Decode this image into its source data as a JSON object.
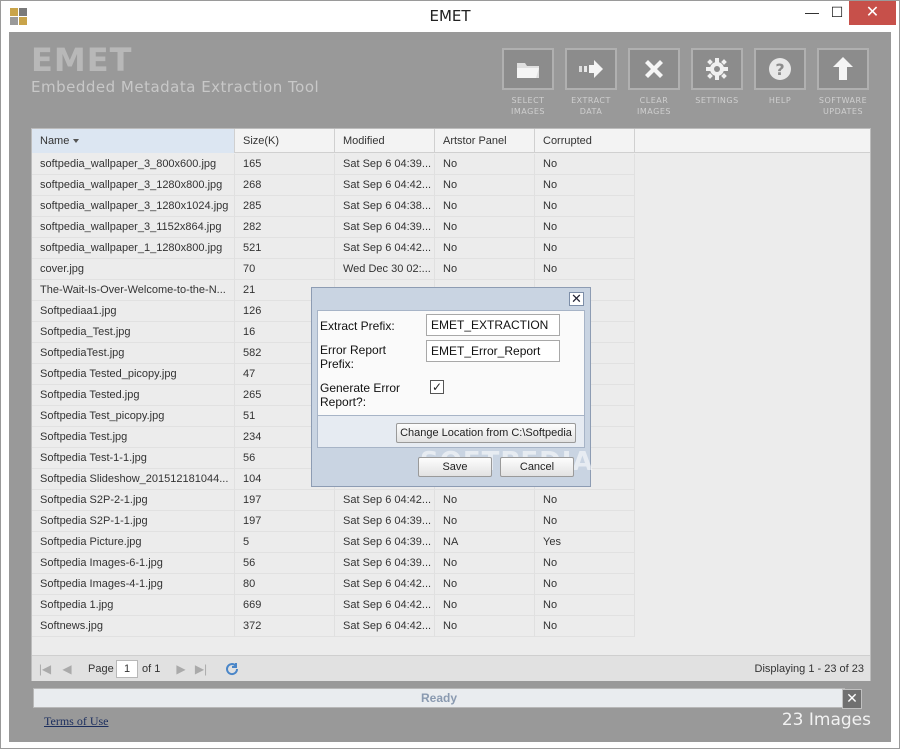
{
  "window": {
    "title": "EMET",
    "controls": {
      "minimize": "—",
      "maximize": "☐",
      "close": "✕"
    }
  },
  "brand": {
    "title": "EMET",
    "subtitle": "Embedded Metadata Extraction Tool"
  },
  "toolbar": [
    {
      "line1": "SELECT",
      "line2": "IMAGES",
      "icon": "folder-icon"
    },
    {
      "line1": "EXTRACT",
      "line2": "DATA",
      "icon": "arrow-right-icon"
    },
    {
      "line1": "CLEAR",
      "line2": "IMAGES",
      "icon": "close-x-icon"
    },
    {
      "line1": "SETTINGS",
      "line2": "",
      "icon": "gear-icon"
    },
    {
      "line1": "HELP",
      "line2": "",
      "icon": "help-icon"
    },
    {
      "line1": "SOFTWARE",
      "line2": "UPDATES",
      "icon": "arrow-up-icon"
    }
  ],
  "table": {
    "columns": [
      "Name",
      "Size(K)",
      "Modified",
      "Artstor Panel",
      "Corrupted"
    ],
    "sorted_column": "Name",
    "rows": [
      [
        "softpedia_wallpaper_3_800x600.jpg",
        "165",
        "Sat Sep 6 04:39...",
        "No",
        "No"
      ],
      [
        "softpedia_wallpaper_3_1280x800.jpg",
        "268",
        "Sat Sep 6 04:42...",
        "No",
        "No"
      ],
      [
        "softpedia_wallpaper_3_1280x1024.jpg",
        "285",
        "Sat Sep 6 04:38...",
        "No",
        "No"
      ],
      [
        "softpedia_wallpaper_3_1152x864.jpg",
        "282",
        "Sat Sep 6 04:39...",
        "No",
        "No"
      ],
      [
        "softpedia_wallpaper_1_1280x800.jpg",
        "521",
        "Sat Sep 6 04:42...",
        "No",
        "No"
      ],
      [
        "cover.jpg",
        "70",
        "Wed Dec 30 02:...",
        "No",
        "No"
      ],
      [
        "The-Wait-Is-Over-Welcome-to-the-N...",
        "21",
        "",
        "",
        ""
      ],
      [
        "Softpediaa1.jpg",
        "126",
        "",
        "",
        ""
      ],
      [
        "Softpedia_Test.jpg",
        "16",
        "",
        "",
        ""
      ],
      [
        "SoftpediaTest.jpg",
        "582",
        "",
        "",
        ""
      ],
      [
        "Softpedia Tested_picopy.jpg",
        "47",
        "",
        "",
        ""
      ],
      [
        "Softpedia Tested.jpg",
        "265",
        "",
        "",
        ""
      ],
      [
        "Softpedia Test_picopy.jpg",
        "51",
        "",
        "",
        ""
      ],
      [
        "Softpedia Test.jpg",
        "234",
        "",
        "",
        ""
      ],
      [
        "Softpedia Test-1-1.jpg",
        "56",
        "",
        "",
        ""
      ],
      [
        "Softpedia Slideshow_201512181044...",
        "104",
        "",
        "",
        ""
      ],
      [
        "Softpedia S2P-2-1.jpg",
        "197",
        "Sat Sep 6 04:42...",
        "No",
        "No"
      ],
      [
        "Softpedia S2P-1-1.jpg",
        "197",
        "Sat Sep 6 04:39...",
        "No",
        "No"
      ],
      [
        "Softpedia Picture.jpg",
        "5",
        "Sat Sep 6 04:39...",
        "NA",
        "Yes"
      ],
      [
        "Softpedia Images-6-1.jpg",
        "56",
        "Sat Sep 6 04:39...",
        "No",
        "No"
      ],
      [
        "Softpedia Images-4-1.jpg",
        "80",
        "Sat Sep 6 04:42...",
        "No",
        "No"
      ],
      [
        "Softpedia 1.jpg",
        "669",
        "Sat Sep 6 04:42...",
        "No",
        "No"
      ],
      [
        "Softnews.jpg",
        "372",
        "Sat Sep 6 04:42...",
        "No",
        "No"
      ]
    ]
  },
  "pager": {
    "page_label": "Page",
    "page_value": "1",
    "of_label": "of 1",
    "display_text": "Displaying 1 - 23 of 23"
  },
  "status": {
    "text": "Ready",
    "close": "✕"
  },
  "footer": {
    "terms": "Terms of Use",
    "count": "23 Images"
  },
  "dialog": {
    "close": "✕",
    "extract_prefix_label": "Extract Prefix:",
    "extract_prefix_value": "EMET_EXTRACTION",
    "error_prefix_label_1": "Error Report",
    "error_prefix_label_2": "Prefix:",
    "error_prefix_value": "EMET_Error_Report",
    "generate_label_1": "Generate Error",
    "generate_label_2": "Report?:",
    "generate_checked": "✓",
    "change_location": "Change Location from C:\\Softpedia",
    "save": "Save",
    "cancel": "Cancel",
    "watermark": "SOFTPEDIA"
  }
}
